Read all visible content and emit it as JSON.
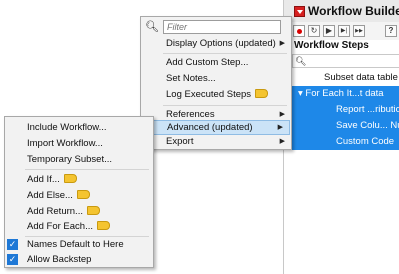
{
  "workflow": {
    "title": "Workflow Builder",
    "steps_title": "Workflow Steps",
    "toolbar": [
      {
        "name": "record-button",
        "glyph": ""
      },
      {
        "name": "undo-button",
        "glyph": "↻"
      },
      {
        "name": "play-button",
        "glyph": "▶"
      },
      {
        "name": "step-button",
        "glyph": "▶|"
      },
      {
        "name": "skip-button",
        "glyph": "▶▶"
      },
      {
        "name": "help-button",
        "glyph": "?"
      }
    ],
    "steps": [
      {
        "text": "Subset data table",
        "selected": false
      },
      {
        "text": "For Each It...t data",
        "selected": true
      },
      {
        "text": "Report ...ributio",
        "selected": true
      },
      {
        "text": "Save Colu... Nu",
        "selected": true
      },
      {
        "text": "Custom Code",
        "selected": true
      }
    ]
  },
  "menu": {
    "filter_placeholder": "Filter",
    "items": [
      {
        "label": "Display Options (updated)",
        "arrow": "▶"
      },
      {
        "label": "Add Custom Step..."
      },
      {
        "label": "Set Notes..."
      },
      {
        "label": "Log Executed Steps",
        "badge": true
      },
      {
        "label": "References",
        "arrow": "▶"
      },
      {
        "label": "Advanced (updated)",
        "arrow": "▶"
      },
      {
        "label": "Export",
        "arrow": "▶"
      }
    ]
  },
  "submenu": {
    "items": [
      {
        "label": "Include Workflow..."
      },
      {
        "label": "Import Workflow..."
      },
      {
        "label": "Temporary Subset..."
      },
      {
        "label": "Add If...",
        "badge": true
      },
      {
        "label": "Add Else...",
        "badge": true
      },
      {
        "label": "Add Return...",
        "badge": true
      },
      {
        "label": "Add For Each...",
        "badge": true
      },
      {
        "label": "Names Default to Here",
        "checked": true
      },
      {
        "label": "Allow Backstep",
        "checked": true
      }
    ]
  },
  "colors": {
    "selection": "#1e88e8",
    "highlight": "#cbe3f7",
    "badge": "#f4c430",
    "check": "#1e78d6"
  }
}
